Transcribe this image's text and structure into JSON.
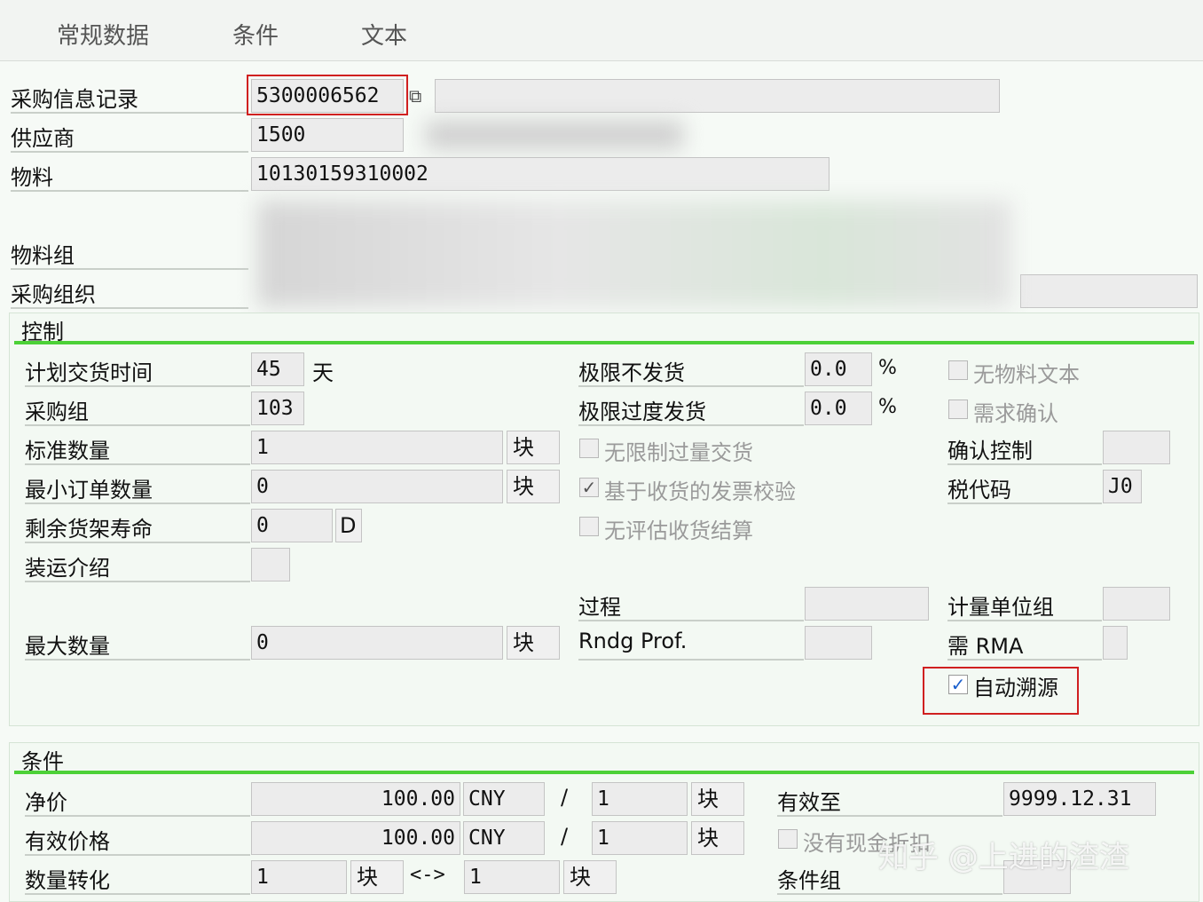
{
  "tabs": [
    "常规数据",
    "条件",
    "文本"
  ],
  "header": {
    "info_record_label": "采购信息记录",
    "info_record_value": "5300006562",
    "vendor_label": "供应商",
    "vendor_value": "1500",
    "material_label": "物料",
    "material_value": "10130159310002",
    "material_group_label": "物料组",
    "purch_org_label": "采购组织"
  },
  "control": {
    "title": "控制",
    "planned_delivery_label": "计划交货时间",
    "planned_delivery_value": "45",
    "planned_delivery_unit": "天",
    "purch_group_label": "采购组",
    "purch_group_value": "103",
    "standard_qty_label": "标准数量",
    "standard_qty_value": "1",
    "standard_qty_unit": "块",
    "min_order_qty_label": "最小订单数量",
    "min_order_qty_value": "0",
    "min_order_qty_unit": "块",
    "shelf_life_label": "剩余货架寿命",
    "shelf_life_value": "0",
    "shelf_life_unit": "D",
    "shipping_instr_label": "装运介绍",
    "max_qty_label": "最大数量",
    "max_qty_value": "0",
    "max_qty_unit": "块",
    "underdelivery_label": "极限不发货",
    "underdelivery_value": "0.0",
    "underdelivery_unit": "%",
    "overdelivery_label": "极限过度发货",
    "overdelivery_value": "0.0",
    "overdelivery_unit": "%",
    "unlimited_overdelivery_label": "无限制过量交货",
    "gr_based_iv_label": "基于收货的发票校验",
    "no_eval_gr_label": "无评估收货结算",
    "procedure_label": "过程",
    "rounding_profile_label": "Rndg Prof.",
    "no_material_text_label": "无物料文本",
    "ack_required_label": "需求确认",
    "confirmation_control_label": "确认控制",
    "tax_code_label": "税代码",
    "tax_code_value": "J0",
    "uom_group_label": "计量单位组",
    "rma_required_label": "需 RMA",
    "auto_sourcing_label": "自动溯源",
    "check_mark": "✓"
  },
  "conditions": {
    "title": "条件",
    "net_price_label": "净价",
    "net_price_value": "100.00",
    "net_price_currency": "CNY",
    "per_sep": "/",
    "net_price_per": "1",
    "net_price_unit": "块",
    "eff_price_label": "有效价格",
    "eff_price_value": "100.00",
    "eff_price_currency": "CNY",
    "eff_price_per": "1",
    "eff_price_unit": "块",
    "qty_conv_label": "数量转化",
    "qty_conv_left": "1",
    "qty_conv_left_unit": "块",
    "qty_conv_sep": "<->",
    "qty_conv_right": "1",
    "qty_conv_right_unit": "块",
    "valid_to_label": "有效至",
    "valid_to_value": "9999.12.31",
    "no_cash_discount_label": "没有现金折扣",
    "cond_group_label": "条件组"
  },
  "watermark": "知乎 @上进的渣渣",
  "colors": {
    "accent_green": "#4cd137",
    "highlight_red": "#d02020",
    "check_blue": "#1a5fcc"
  }
}
